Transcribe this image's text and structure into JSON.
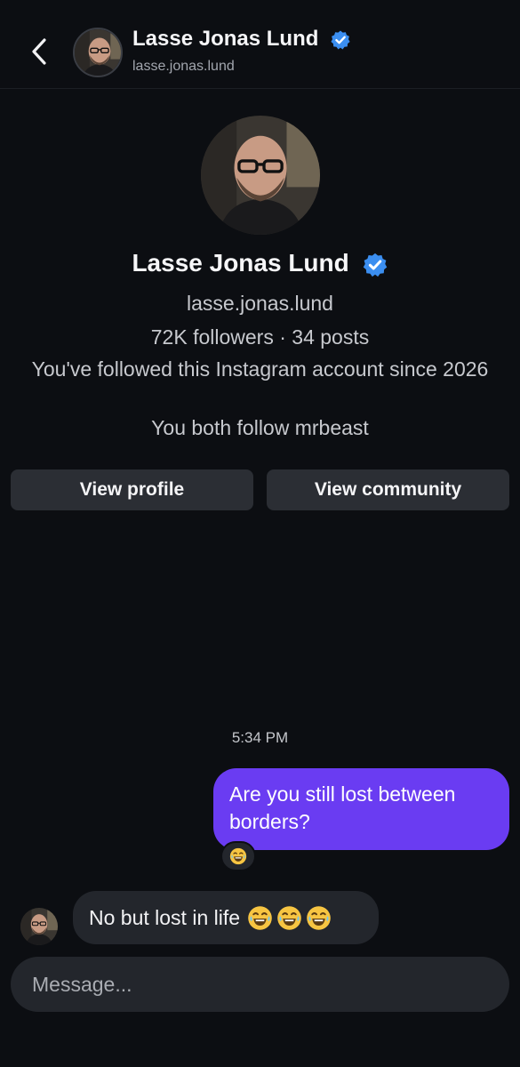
{
  "header": {
    "name": "Lasse Jonas Lund",
    "username": "lasse.jonas.lund"
  },
  "profile": {
    "name": "Lasse Jonas Lund",
    "username": "lasse.jonas.lund",
    "stats": "72K followers · 34 posts",
    "followed_since": "You've followed this Instagram account since 2026",
    "mutual": "You both follow mrbeast",
    "view_profile_label": "View profile",
    "view_community_label": "View community"
  },
  "conversation": {
    "timestamp": "5:34 PM",
    "messages": [
      {
        "from": "me",
        "text": "Are you still lost between borders?",
        "reaction": "laughing-emoji"
      },
      {
        "from": "them",
        "text": "No but lost in life",
        "emojis": [
          "laughing-emoji",
          "laughing-emoji",
          "laughing-emoji"
        ]
      }
    ]
  },
  "composer": {
    "placeholder": "Message..."
  },
  "colors": {
    "background": "#0c0e12",
    "outgoing_bubble": "#6a3cf2",
    "incoming_bubble": "#23262c",
    "button": "#2b2e34",
    "verified": "#3b8ef0"
  }
}
